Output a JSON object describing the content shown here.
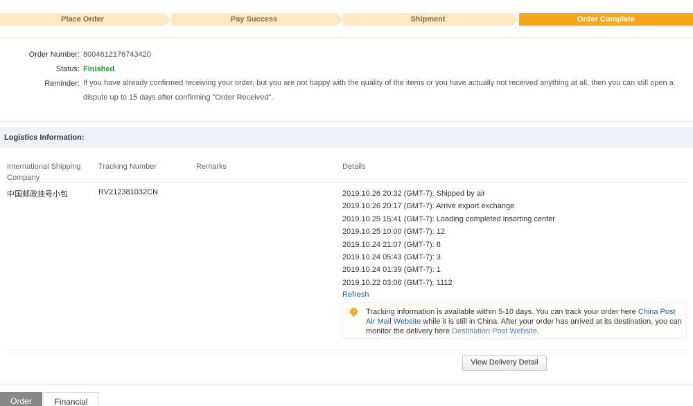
{
  "steps": [
    {
      "label": "Place Order",
      "active": false
    },
    {
      "label": "Pay Success",
      "active": false
    },
    {
      "label": "Shipment",
      "active": false
    },
    {
      "label": "Order Complete",
      "active": true
    }
  ],
  "order": {
    "number_label": "Order Number:",
    "number_value": "8004612176743420",
    "status_label": "Status:",
    "status_value": "Finished",
    "reminder_label": "Reminder:",
    "reminder_text": "If you have already confirmed receiving your order, but you are not happy with the quality of the items or you have actually not received anything at all, then you can still open a dispute up to 15 days after confirming \"Order Received\"."
  },
  "logistics": {
    "title": "Logistics Information:",
    "columns": {
      "company": "International Shipping Company",
      "tracking": "Tracking Number",
      "remarks": "Remarks",
      "details": "Details"
    },
    "row": {
      "company": "中国邮政挂号小包",
      "tracking": "RV212381032CN",
      "remarks": ""
    },
    "details": [
      "2019.10.26 20:32 (GMT-7): Shipped by air",
      "2019.10.26 20:17 (GMT-7): Arrive export exchange",
      "2019.10.25 15:41 (GMT-7): Loading completed insorting center",
      "2019.10.25 10:00 (GMT-7): 12",
      "2019.10.24 21:07 (GMT-7): 8",
      "2019.10.24 05:43 (GMT-7): 3",
      "2019.10.24 01:39 (GMT-7): 1",
      "2019.10.22 03:06 (GMT-7): 1112"
    ],
    "refresh_label": "Refresh",
    "notice": {
      "text_1": "Tracking information is available within 5-10 days. You can track your order here ",
      "link_1": "China Post Air Mail Website",
      "text_2": " while it is still in China. After your order has arrived at its destination, you can monitor the delivery here ",
      "link_2": "Destination Post Website",
      "text_3": "."
    },
    "view_button": "View Delivery Detail"
  },
  "tabs": [
    {
      "label": "Order",
      "active": true
    },
    {
      "label": "Financial",
      "active": false
    }
  ],
  "colors": {
    "accent": "#f7a51c",
    "step_inactive": "#fde9c4",
    "status_green": "#1a9d2e",
    "link_blue": "#1a5fa8",
    "logistics_bg": "#eef3fb"
  }
}
